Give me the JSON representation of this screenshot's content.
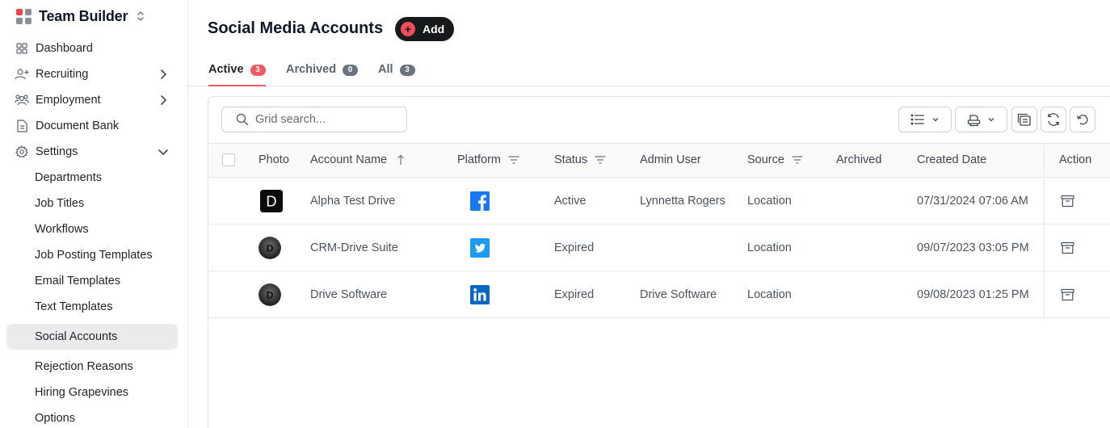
{
  "app": {
    "title": "Team Builder",
    "logo_colors": [
      "#e5484d",
      "#8d8f98",
      "#8d8f98",
      "#8d8f98"
    ]
  },
  "sidebar": {
    "items": [
      {
        "label": "Dashboard",
        "icon": "grid-icon"
      },
      {
        "label": "Recruiting",
        "icon": "user-plus-icon"
      },
      {
        "label": "Employment",
        "icon": "users-icon"
      },
      {
        "label": "Document Bank",
        "icon": "document-icon"
      },
      {
        "label": "Settings",
        "icon": "gear-icon"
      }
    ],
    "settings_children": [
      "Departments",
      "Job Titles",
      "Workflows",
      "Job Posting Templates",
      "Email Templates",
      "Text Templates",
      "Social Accounts",
      "Rejection Reasons",
      "Hiring Grapevines",
      "Options"
    ],
    "active_child": "Social Accounts"
  },
  "page": {
    "title": "Social Media Accounts",
    "add_label": "Add"
  },
  "tabs": [
    {
      "label": "Active",
      "count": "3",
      "badge_color": "#ef5a63"
    },
    {
      "label": "Archived",
      "count": "0",
      "badge_color": "#6b7280"
    },
    {
      "label": "All",
      "count": "3",
      "badge_color": "#6b7280"
    }
  ],
  "search": {
    "placeholder": "Grid search..."
  },
  "table": {
    "columns": [
      "Photo",
      "Account Name",
      "Platform",
      "Status",
      "Admin User",
      "Source",
      "Archived",
      "Created Date",
      "Action"
    ],
    "rows": [
      {
        "photo": "D",
        "name": "Alpha Test Drive",
        "platform": "facebook",
        "status": "Active",
        "admin": "Lynnetta Rogers",
        "source": "Location",
        "archived": "",
        "created": "07/31/2024 07:06 AM"
      },
      {
        "photo": "D",
        "name": "CRM-Drive Suite",
        "platform": "twitter",
        "status": "Expired",
        "admin": "",
        "source": "Location",
        "archived": "",
        "created": "09/07/2023 03:05 PM"
      },
      {
        "photo": "D",
        "name": "Drive Software",
        "platform": "linkedin",
        "status": "Expired",
        "admin": "Drive Software",
        "source": "Location",
        "archived": "",
        "created": "09/08/2023 01:25 PM"
      }
    ]
  },
  "colors": {
    "facebook": "#1877f2",
    "twitter": "#1d9bf0",
    "linkedin": "#0a66c2",
    "accent": "#ef5a63"
  }
}
